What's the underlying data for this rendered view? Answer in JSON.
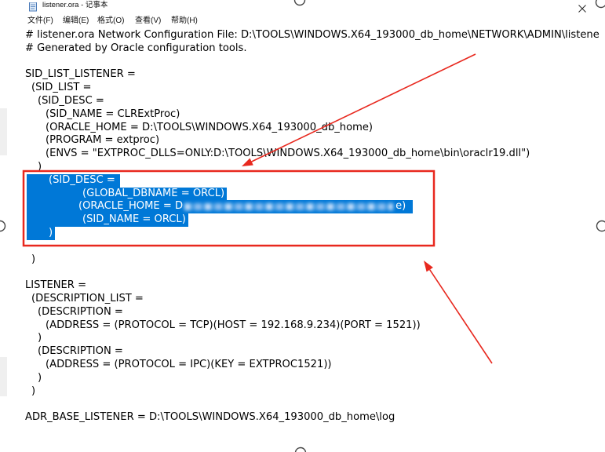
{
  "window": {
    "title": "listener.ora - 记事本"
  },
  "icons": {
    "app": "notepad-icon",
    "close": "close-icon"
  },
  "menu": [
    "文件(F)",
    "编辑(E)",
    "格式(O)",
    "查看(V)",
    "帮助(H)"
  ],
  "editor": {
    "lines": [
      "# listener.ora Network Configuration File: D:\\TOOLS\\WINDOWS.X64_193000_db_home\\NETWORK\\ADMIN\\listene",
      "# Generated by Oracle configuration tools.",
      "SID_LIST_LISTENER =",
      "(SID_LIST =",
      "(SID_DESC =",
      "(SID_NAME = CLRExtProc)",
      "(ORACLE_HOME = D:\\TOOLS\\WINDOWS.X64_193000_db_home)",
      "(PROGRAM = extproc)",
      "(ENVS = \"EXTPROC_DLLS=ONLY:D:\\TOOLS\\WINDOWS.X64_193000_db_home\\bin\\oraclr19.dll\")",
      ")",
      "(SID_DESC =",
      "(GLOBAL_DBNAME = ORCL)",
      {
        "before": "(ORACLE_HOME = D",
        "after": "e)"
      },
      "(SID_NAME = ORCL)",
      ")",
      ")",
      "LISTENER =",
      "(DESCRIPTION_LIST =",
      "(DESCRIPTION =",
      "(ADDRESS = (PROTOCOL = TCP)(HOST = 192.168.9.234)(PORT = 1521))",
      ")",
      "(DESCRIPTION =",
      "(ADDRESS = (PROTOCOL = IPC)(KEY = EXTPROC1521))",
      ")",
      ")",
      "ADR_BASE_LISTENER = D:\\TOOLS\\WINDOWS.X64_193000_db_home\\log"
    ]
  },
  "colors": {
    "selection": "#0078d7",
    "annotation": "#e8281e"
  }
}
